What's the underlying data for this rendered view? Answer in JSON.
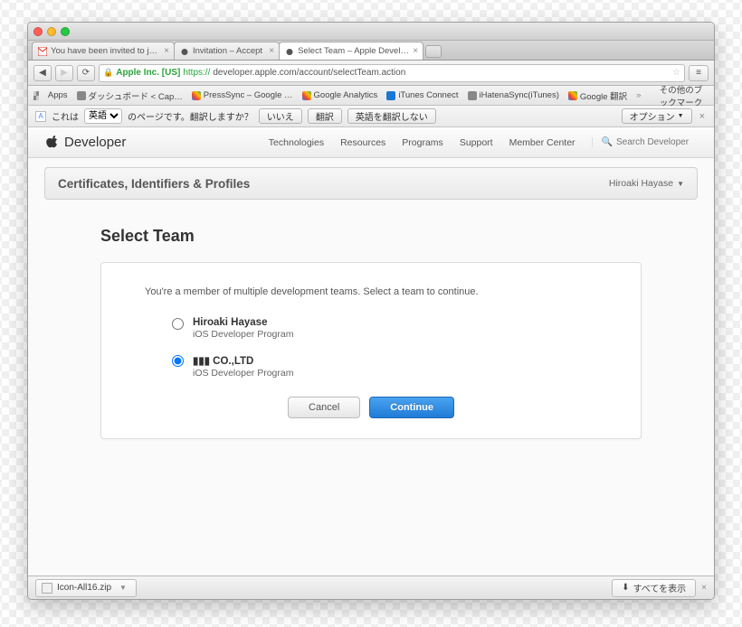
{
  "tabs": [
    {
      "label": "You have been invited to j…"
    },
    {
      "label": "Invitation – Accept"
    },
    {
      "label": "Select Team – Apple Devel…"
    }
  ],
  "url": {
    "org": "Apple Inc. [US]",
    "proto": "https://",
    "rest": "developer.apple.com/account/selectTeam.action"
  },
  "bookmarks": {
    "apps": "Apps",
    "items": [
      "ダッシュボード < Cap…",
      "PressSync – Google …",
      "Google Analytics",
      "iTunes Connect",
      "iHatenaSync(iTunes)",
      "Google 翻訳"
    ],
    "other": "その他のブックマーク"
  },
  "translate": {
    "prefix": "これは",
    "lang": "英語",
    "suffix": "のページです。翻訳しますか？",
    "no": "いいえ",
    "yes": "翻訳",
    "never": "英語を翻訳しない",
    "options": "オプション"
  },
  "dev": {
    "brand": "Developer",
    "nav": [
      "Technologies",
      "Resources",
      "Programs",
      "Support",
      "Member Center"
    ],
    "search_placeholder": "Search Developer"
  },
  "subhead": {
    "title": "Certificates, Identifiers & Profiles",
    "user": "Hiroaki Hayase"
  },
  "page": {
    "heading": "Select Team",
    "prompt": "You're a member of multiple development teams. Select a team to continue.",
    "teams": [
      {
        "name": "Hiroaki Hayase",
        "program": "iOS Developer Program",
        "selected": false,
        "blur": false
      },
      {
        "name": "▮▮▮ CO.,LTD",
        "program": "iOS Developer Program",
        "selected": true,
        "blur": true
      }
    ],
    "cancel": "Cancel",
    "continue": "Continue"
  },
  "download": {
    "file": "Icon-All16.zip",
    "showall": "すべてを表示"
  }
}
